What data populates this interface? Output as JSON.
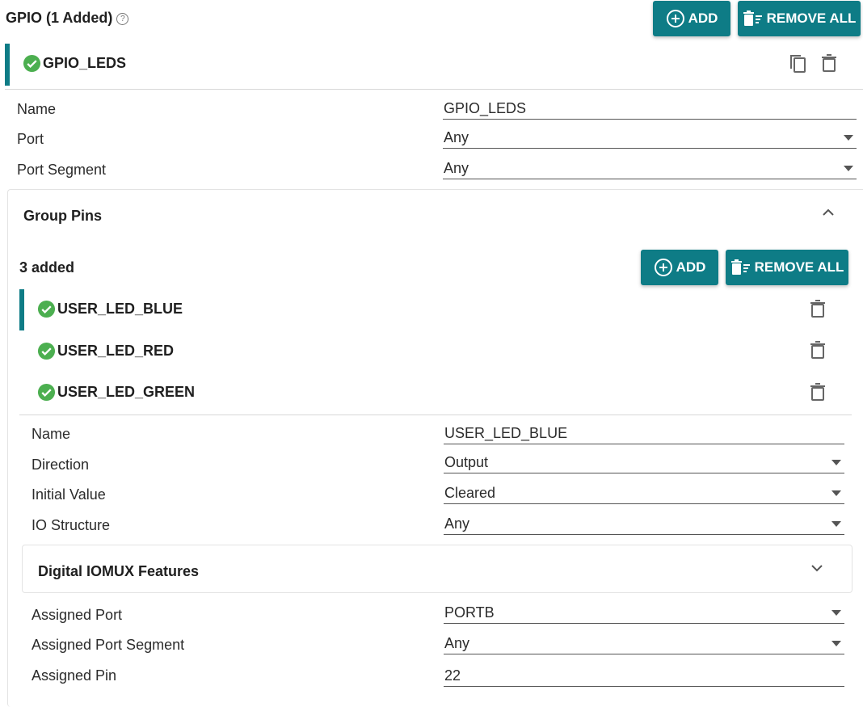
{
  "header": {
    "title": "GPIO (1 Added)",
    "help_glyph": "?",
    "add_label": "ADD",
    "remove_all_label": "REMOVE ALL"
  },
  "instance": {
    "name": "GPIO_LEDS",
    "status": "valid",
    "fields": [
      {
        "label": "Name",
        "value": "GPIO_LEDS",
        "type": "text"
      },
      {
        "label": "Port",
        "value": "Any",
        "type": "select"
      },
      {
        "label": "Port Segment",
        "value": "Any",
        "type": "select"
      }
    ]
  },
  "group_pins": {
    "title": "Group Pins",
    "count_label": "3 added",
    "add_label": "ADD",
    "remove_all_label": "REMOVE ALL",
    "pins": [
      {
        "name": "USER_LED_BLUE",
        "selected": true
      },
      {
        "name": "USER_LED_RED",
        "selected": false
      },
      {
        "name": "USER_LED_GREEN",
        "selected": false
      }
    ],
    "fields": [
      {
        "label": "Name",
        "value": "USER_LED_BLUE",
        "type": "text"
      },
      {
        "label": "Direction",
        "value": "Output",
        "type": "select"
      },
      {
        "label": "Initial Value",
        "value": "Cleared",
        "type": "select"
      },
      {
        "label": "IO Structure",
        "value": "Any",
        "type": "select"
      }
    ],
    "iomux": {
      "title": "Digital IOMUX Features",
      "expanded": false
    },
    "assigned_fields": [
      {
        "label": "Assigned Port",
        "value": "PORTB",
        "type": "select"
      },
      {
        "label": "Assigned Port Segment",
        "value": "Any",
        "type": "select"
      },
      {
        "label": "Assigned Pin",
        "value": "22",
        "type": "text"
      }
    ]
  },
  "colors": {
    "accent": "#0e7c86",
    "check": "#4caf50"
  }
}
